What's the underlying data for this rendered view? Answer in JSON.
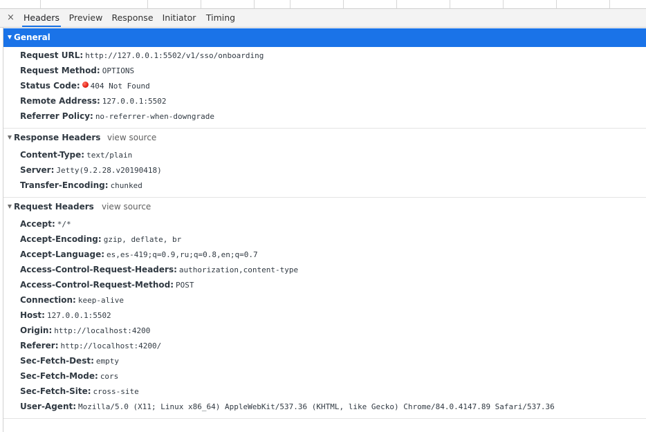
{
  "tabs": {
    "close_icon": "×",
    "items": [
      "Headers",
      "Preview",
      "Response",
      "Initiator",
      "Timing"
    ],
    "active": "Headers"
  },
  "general": {
    "title": "General",
    "rows": [
      {
        "name": "Request URL:",
        "value": "http://127.0.0.1:5502/v1/sso/onboarding"
      },
      {
        "name": "Request Method:",
        "value": "OPTIONS"
      },
      {
        "name": "Status Code:",
        "value": "404 Not Found",
        "status_color": "#e8261a"
      },
      {
        "name": "Remote Address:",
        "value": "127.0.0.1:5502"
      },
      {
        "name": "Referrer Policy:",
        "value": "no-referrer-when-downgrade"
      }
    ]
  },
  "response_headers": {
    "title": "Response Headers",
    "view_source": "view source",
    "rows": [
      {
        "name": "Content-Type:",
        "value": "text/plain"
      },
      {
        "name": "Server:",
        "value": "Jetty(9.2.28.v20190418)"
      },
      {
        "name": "Transfer-Encoding:",
        "value": "chunked"
      }
    ]
  },
  "request_headers": {
    "title": "Request Headers",
    "view_source": "view source",
    "rows": [
      {
        "name": "Accept:",
        "value": "*/*"
      },
      {
        "name": "Accept-Encoding:",
        "value": "gzip, deflate, br"
      },
      {
        "name": "Accept-Language:",
        "value": "es,es-419;q=0.9,ru;q=0.8,en;q=0.7"
      },
      {
        "name": "Access-Control-Request-Headers:",
        "value": "authorization,content-type"
      },
      {
        "name": "Access-Control-Request-Method:",
        "value": "POST"
      },
      {
        "name": "Connection:",
        "value": "keep-alive"
      },
      {
        "name": "Host:",
        "value": "127.0.0.1:5502"
      },
      {
        "name": "Origin:",
        "value": "http://localhost:4200"
      },
      {
        "name": "Referer:",
        "value": "http://localhost:4200/"
      },
      {
        "name": "Sec-Fetch-Dest:",
        "value": "empty"
      },
      {
        "name": "Sec-Fetch-Mode:",
        "value": "cors"
      },
      {
        "name": "Sec-Fetch-Site:",
        "value": "cross-site"
      },
      {
        "name": "User-Agent:",
        "value": "Mozilla/5.0 (X11; Linux x86_64) AppleWebKit/537.36 (KHTML, like Gecko) Chrome/84.0.4147.89 Safari/537.36"
      }
    ]
  },
  "colors": {
    "accent": "#1a73e8",
    "status_error": "#e8261a"
  }
}
